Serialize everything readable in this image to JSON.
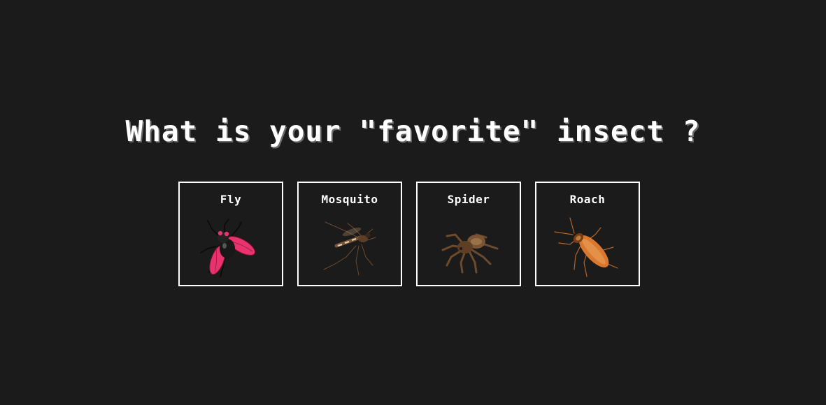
{
  "question": "What is your \"favorite\" insect ?",
  "options": [
    {
      "label": "Fly",
      "icon": "fly-icon"
    },
    {
      "label": "Mosquito",
      "icon": "mosquito-icon"
    },
    {
      "label": "Spider",
      "icon": "spider-icon"
    },
    {
      "label": "Roach",
      "icon": "roach-icon"
    }
  ],
  "colors": {
    "background": "#1b1b1b",
    "text": "#ffffff",
    "border": "#ffffff",
    "fly_wing": "#e8336e",
    "roach_body": "#d9782e"
  }
}
